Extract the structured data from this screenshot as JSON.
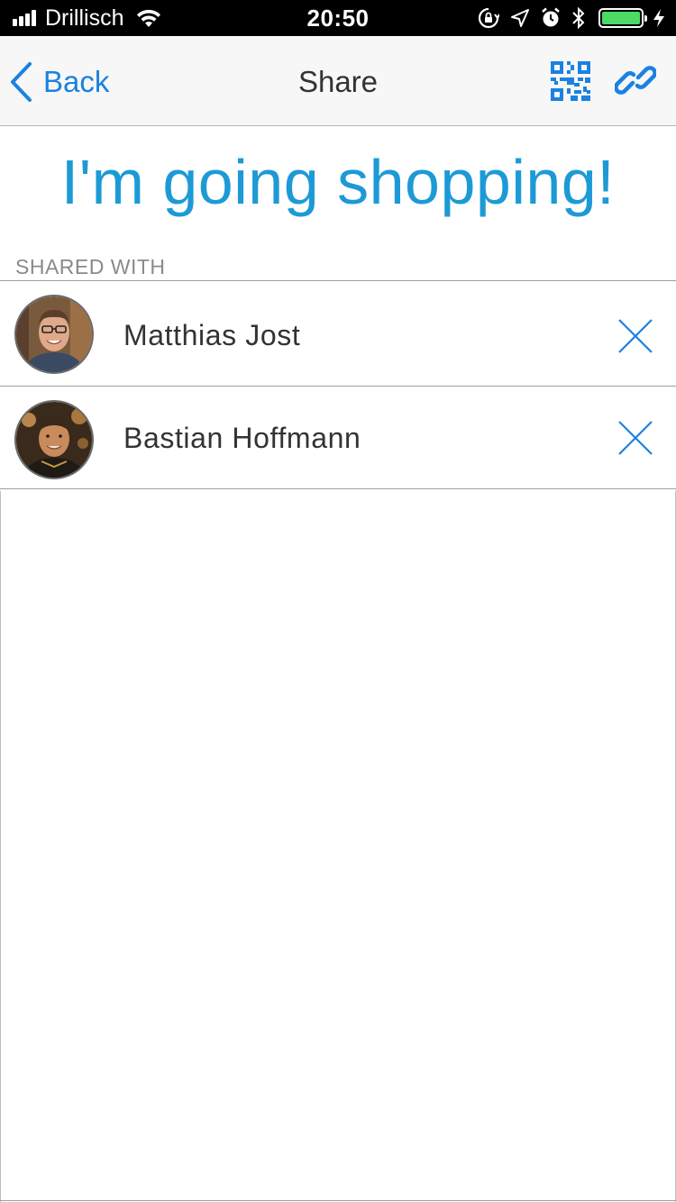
{
  "status_bar": {
    "carrier": "Drillisch",
    "time": "20:50",
    "signal_bars": 4,
    "battery_level": 1.0,
    "icons": [
      "wifi-icon",
      "orientation-lock-icon",
      "location-icon",
      "alarm-icon",
      "bluetooth-icon",
      "battery-icon",
      "charging-icon"
    ]
  },
  "nav": {
    "back_label": "Back",
    "title": "Share",
    "icons": [
      "chevron-left-icon",
      "qr-code-icon",
      "link-icon"
    ]
  },
  "main": {
    "list_title": "I'm going shopping!",
    "section_header": "SHARED WITH",
    "people": [
      {
        "name": "Matthias Jost"
      },
      {
        "name": "Bastian Hoffmann"
      }
    ]
  },
  "colors": {
    "accent": "#1a82e0",
    "title": "#1d9ad6",
    "battery": "#4cd964",
    "nav_background": "#f7f7f7"
  }
}
